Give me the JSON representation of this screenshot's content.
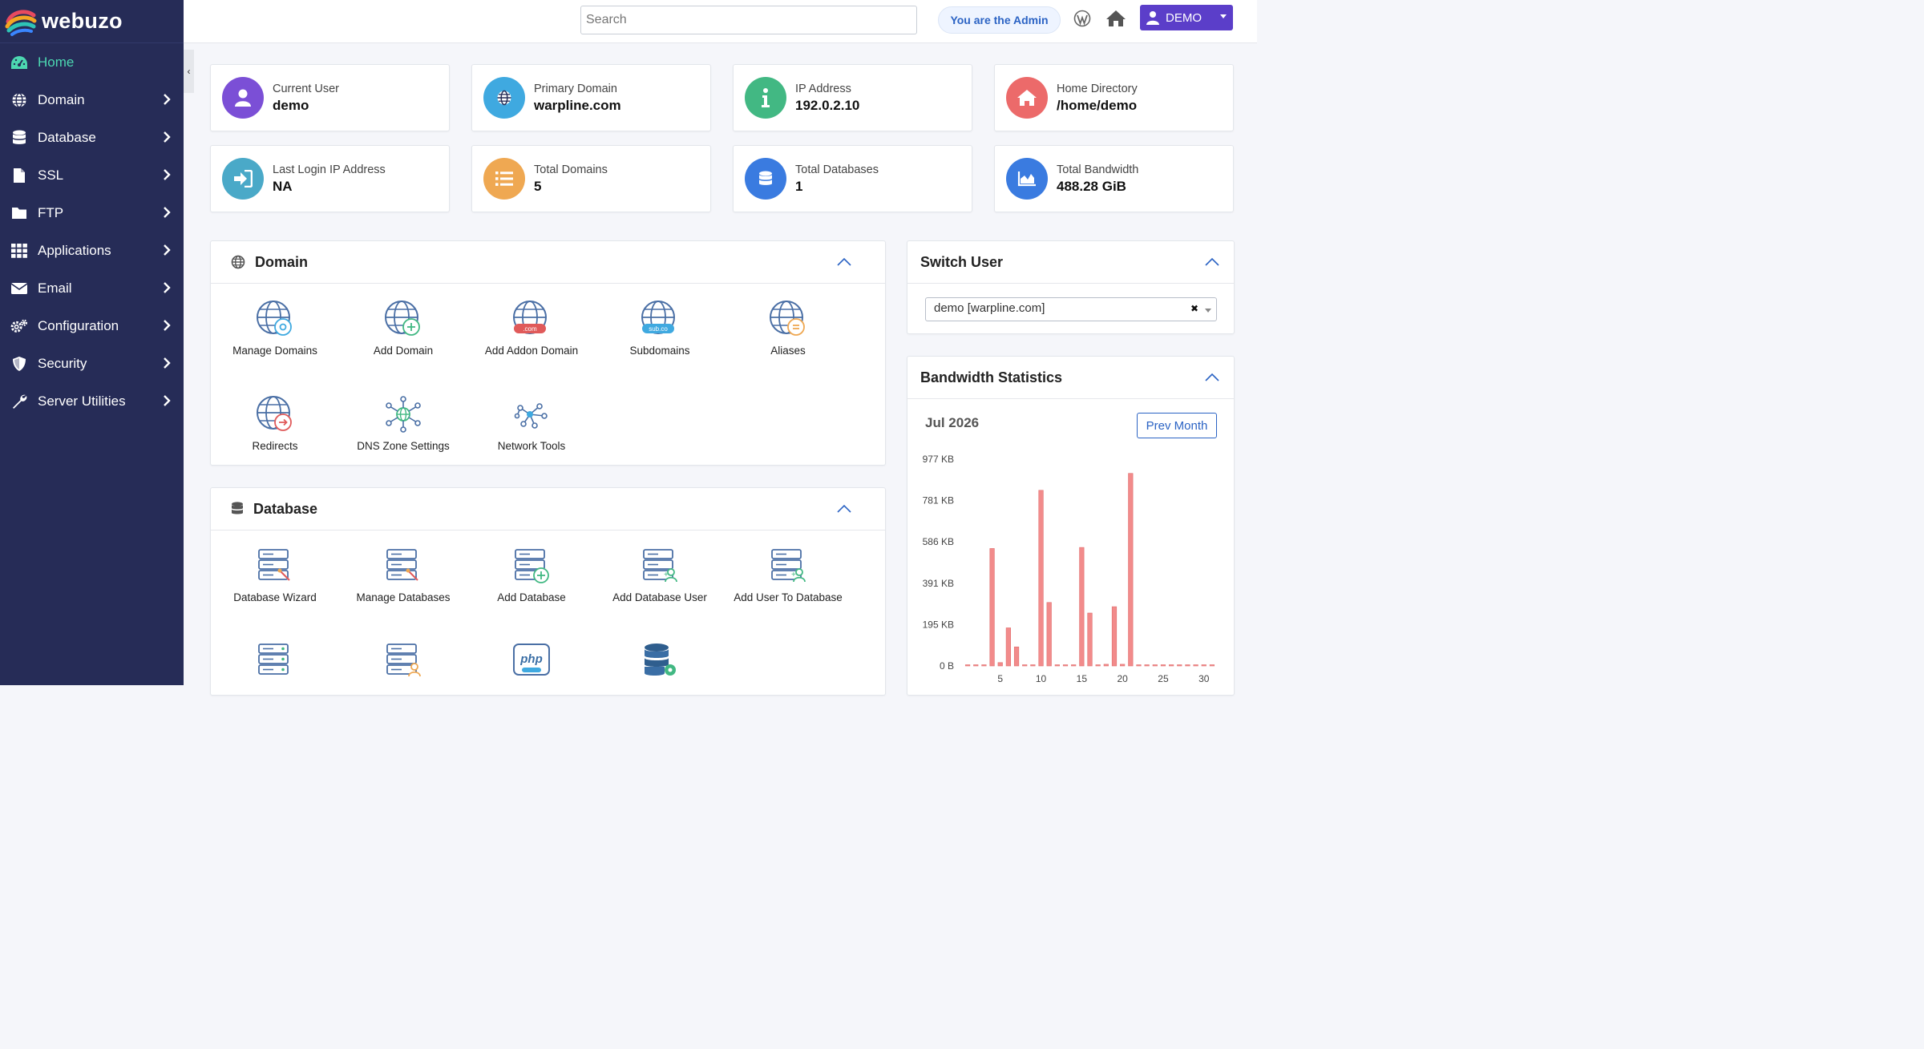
{
  "brand": {
    "name": "webuzo"
  },
  "sidebar": {
    "items": [
      {
        "label": "Home",
        "icon": "dashboard-icon",
        "active": true
      },
      {
        "label": "Domain",
        "icon": "globe-icon"
      },
      {
        "label": "Database",
        "icon": "database-icon"
      },
      {
        "label": "SSL",
        "icon": "file-icon"
      },
      {
        "label": "FTP",
        "icon": "folder-icon"
      },
      {
        "label": "Applications",
        "icon": "grid-icon"
      },
      {
        "label": "Email",
        "icon": "envelope-icon"
      },
      {
        "label": "Configuration",
        "icon": "gears-icon"
      },
      {
        "label": "Security",
        "icon": "shield-icon"
      },
      {
        "label": "Server Utilities",
        "icon": "wrench-icon"
      }
    ]
  },
  "topbar": {
    "search_placeholder": "Search",
    "admin_label": "You are the Admin",
    "user_button": "DEMO"
  },
  "info_cards": [
    {
      "label": "Current User",
      "value": "demo",
      "color": "#7b4fd6",
      "icon": "user-icon"
    },
    {
      "label": "Primary Domain",
      "value": "warpline.com",
      "color": "#3fa9e0",
      "icon": "globe-icon"
    },
    {
      "label": "IP Address",
      "value": "192.0.2.10",
      "color": "#42b883",
      "icon": "info-icon"
    },
    {
      "label": "Home Directory",
      "value": "/home/demo",
      "color": "#ec6a6a",
      "icon": "house-icon"
    },
    {
      "label": "Last Login IP Address",
      "value": "NA",
      "color": "#4aa9c8",
      "icon": "sign-in-icon"
    },
    {
      "label": "Total Domains",
      "value": "5",
      "color": "#efa852",
      "icon": "list-icon"
    },
    {
      "label": "Total Databases",
      "value": "1",
      "color": "#3a7be0",
      "icon": "database-icon"
    },
    {
      "label": "Total Bandwidth",
      "value": "488.28 GiB",
      "color": "#3a7be0",
      "icon": "area-chart-icon"
    }
  ],
  "domain_panel": {
    "title": "Domain",
    "tiles": [
      {
        "label": "Manage Domains",
        "icon": "manage-domains-icon"
      },
      {
        "label": "Add Domain",
        "icon": "add-domain-icon"
      },
      {
        "label": "Add Addon Domain",
        "icon": "addon-domain-icon",
        "badge": ".com"
      },
      {
        "label": "Subdomains",
        "icon": "subdomains-icon",
        "badge": "sub.co"
      },
      {
        "label": "Aliases",
        "icon": "aliases-icon"
      },
      {
        "label": "Redirects",
        "icon": "redirects-icon"
      },
      {
        "label": "DNS Zone Settings",
        "icon": "dns-zone-icon"
      },
      {
        "label": "Network Tools",
        "icon": "network-tools-icon"
      }
    ]
  },
  "database_panel": {
    "title": "Database",
    "tiles": [
      {
        "label": "Database Wizard",
        "icon": "database-wizard-icon"
      },
      {
        "label": "Manage Databases",
        "icon": "manage-databases-icon"
      },
      {
        "label": "Add Database",
        "icon": "add-database-icon"
      },
      {
        "label": "Add Database User",
        "icon": "add-database-user-icon"
      },
      {
        "label": "Add User To Database",
        "icon": "add-user-to-database-icon"
      }
    ],
    "more_icons": [
      "server-icon",
      "database-user-icon",
      "phpmyadmin-icon",
      "database-settings-icon"
    ]
  },
  "switch_user": {
    "title": "Switch User",
    "selected": "demo [warpline.com]"
  },
  "bandwidth": {
    "title": "Bandwidth Statistics",
    "month": "Jul 2026",
    "prev_button": "Prev Month"
  },
  "chart_data": {
    "type": "bar",
    "title": "Bandwidth Statistics",
    "x": [
      1,
      2,
      3,
      4,
      5,
      6,
      7,
      8,
      9,
      10,
      11,
      12,
      13,
      14,
      15,
      16,
      17,
      18,
      19,
      20,
      21,
      22,
      23,
      24,
      25,
      26,
      27,
      28,
      29,
      30,
      31
    ],
    "values": [
      0,
      2,
      3,
      555,
      16,
      180,
      90,
      4,
      0,
      830,
      300,
      3,
      3,
      5,
      560,
      250,
      5,
      8,
      280,
      8,
      910,
      3,
      2,
      3,
      5,
      2,
      3,
      4,
      2,
      3,
      1
    ],
    "units": "KB",
    "y_ticks": [
      "0 B",
      "195 KB",
      "391 KB",
      "586 KB",
      "781 KB",
      "977 KB"
    ],
    "x_ticks": [
      "5",
      "10",
      "15",
      "20",
      "25",
      "30"
    ],
    "ylim": [
      0,
      977
    ],
    "color": "#f28b8b"
  }
}
